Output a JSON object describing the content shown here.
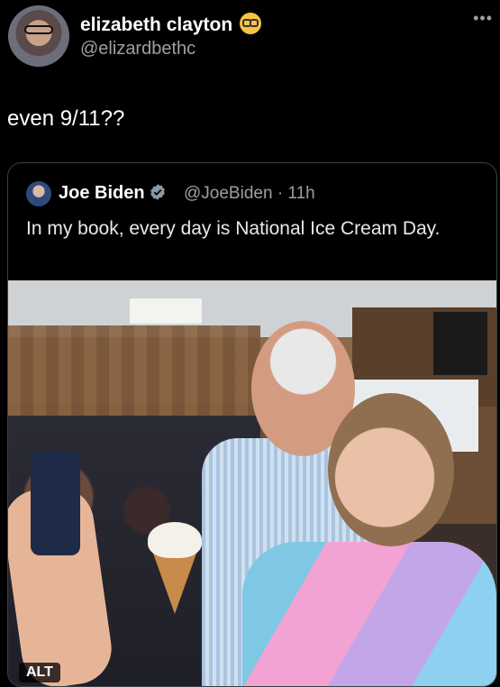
{
  "tweet": {
    "author_name": "elizabeth clayton",
    "author_handle": "@elizardbethc",
    "author_emoji": "nerd-face-emoji",
    "text": "even 9/11??",
    "more_icon": "•••"
  },
  "quoted_tweet": {
    "author_name": "Joe Biden",
    "verified": true,
    "author_handle": "@JoeBiden",
    "timestamp": "· 11h",
    "text": "In my book, every day is National Ice Cream Day.",
    "media": {
      "alt_badge": "ALT",
      "description_icon": "photo"
    }
  },
  "colors": {
    "background": "#000000",
    "text_primary": "#ffffff",
    "text_secondary": "#9aa0a6",
    "border": "#3c4043",
    "verified_blue": "#1d9bf0"
  }
}
